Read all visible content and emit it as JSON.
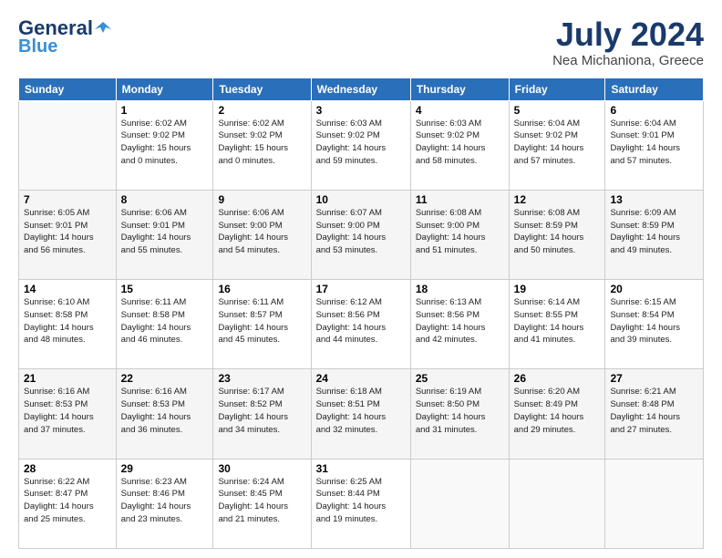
{
  "header": {
    "logo_line1": "General",
    "logo_line2": "Blue",
    "month": "July 2024",
    "location": "Nea Michaniona, Greece"
  },
  "weekdays": [
    "Sunday",
    "Monday",
    "Tuesday",
    "Wednesday",
    "Thursday",
    "Friday",
    "Saturday"
  ],
  "weeks": [
    [
      {
        "day": "",
        "sunrise": "",
        "sunset": "",
        "daylight": ""
      },
      {
        "day": "1",
        "sunrise": "Sunrise: 6:02 AM",
        "sunset": "Sunset: 9:02 PM",
        "daylight": "Daylight: 15 hours and 0 minutes."
      },
      {
        "day": "2",
        "sunrise": "Sunrise: 6:02 AM",
        "sunset": "Sunset: 9:02 PM",
        "daylight": "Daylight: 15 hours and 0 minutes."
      },
      {
        "day": "3",
        "sunrise": "Sunrise: 6:03 AM",
        "sunset": "Sunset: 9:02 PM",
        "daylight": "Daylight: 14 hours and 59 minutes."
      },
      {
        "day": "4",
        "sunrise": "Sunrise: 6:03 AM",
        "sunset": "Sunset: 9:02 PM",
        "daylight": "Daylight: 14 hours and 58 minutes."
      },
      {
        "day": "5",
        "sunrise": "Sunrise: 6:04 AM",
        "sunset": "Sunset: 9:02 PM",
        "daylight": "Daylight: 14 hours and 57 minutes."
      },
      {
        "day": "6",
        "sunrise": "Sunrise: 6:04 AM",
        "sunset": "Sunset: 9:01 PM",
        "daylight": "Daylight: 14 hours and 57 minutes."
      }
    ],
    [
      {
        "day": "7",
        "sunrise": "Sunrise: 6:05 AM",
        "sunset": "Sunset: 9:01 PM",
        "daylight": "Daylight: 14 hours and 56 minutes."
      },
      {
        "day": "8",
        "sunrise": "Sunrise: 6:06 AM",
        "sunset": "Sunset: 9:01 PM",
        "daylight": "Daylight: 14 hours and 55 minutes."
      },
      {
        "day": "9",
        "sunrise": "Sunrise: 6:06 AM",
        "sunset": "Sunset: 9:00 PM",
        "daylight": "Daylight: 14 hours and 54 minutes."
      },
      {
        "day": "10",
        "sunrise": "Sunrise: 6:07 AM",
        "sunset": "Sunset: 9:00 PM",
        "daylight": "Daylight: 14 hours and 53 minutes."
      },
      {
        "day": "11",
        "sunrise": "Sunrise: 6:08 AM",
        "sunset": "Sunset: 9:00 PM",
        "daylight": "Daylight: 14 hours and 51 minutes."
      },
      {
        "day": "12",
        "sunrise": "Sunrise: 6:08 AM",
        "sunset": "Sunset: 8:59 PM",
        "daylight": "Daylight: 14 hours and 50 minutes."
      },
      {
        "day": "13",
        "sunrise": "Sunrise: 6:09 AM",
        "sunset": "Sunset: 8:59 PM",
        "daylight": "Daylight: 14 hours and 49 minutes."
      }
    ],
    [
      {
        "day": "14",
        "sunrise": "Sunrise: 6:10 AM",
        "sunset": "Sunset: 8:58 PM",
        "daylight": "Daylight: 14 hours and 48 minutes."
      },
      {
        "day": "15",
        "sunrise": "Sunrise: 6:11 AM",
        "sunset": "Sunset: 8:58 PM",
        "daylight": "Daylight: 14 hours and 46 minutes."
      },
      {
        "day": "16",
        "sunrise": "Sunrise: 6:11 AM",
        "sunset": "Sunset: 8:57 PM",
        "daylight": "Daylight: 14 hours and 45 minutes."
      },
      {
        "day": "17",
        "sunrise": "Sunrise: 6:12 AM",
        "sunset": "Sunset: 8:56 PM",
        "daylight": "Daylight: 14 hours and 44 minutes."
      },
      {
        "day": "18",
        "sunrise": "Sunrise: 6:13 AM",
        "sunset": "Sunset: 8:56 PM",
        "daylight": "Daylight: 14 hours and 42 minutes."
      },
      {
        "day": "19",
        "sunrise": "Sunrise: 6:14 AM",
        "sunset": "Sunset: 8:55 PM",
        "daylight": "Daylight: 14 hours and 41 minutes."
      },
      {
        "day": "20",
        "sunrise": "Sunrise: 6:15 AM",
        "sunset": "Sunset: 8:54 PM",
        "daylight": "Daylight: 14 hours and 39 minutes."
      }
    ],
    [
      {
        "day": "21",
        "sunrise": "Sunrise: 6:16 AM",
        "sunset": "Sunset: 8:53 PM",
        "daylight": "Daylight: 14 hours and 37 minutes."
      },
      {
        "day": "22",
        "sunrise": "Sunrise: 6:16 AM",
        "sunset": "Sunset: 8:53 PM",
        "daylight": "Daylight: 14 hours and 36 minutes."
      },
      {
        "day": "23",
        "sunrise": "Sunrise: 6:17 AM",
        "sunset": "Sunset: 8:52 PM",
        "daylight": "Daylight: 14 hours and 34 minutes."
      },
      {
        "day": "24",
        "sunrise": "Sunrise: 6:18 AM",
        "sunset": "Sunset: 8:51 PM",
        "daylight": "Daylight: 14 hours and 32 minutes."
      },
      {
        "day": "25",
        "sunrise": "Sunrise: 6:19 AM",
        "sunset": "Sunset: 8:50 PM",
        "daylight": "Daylight: 14 hours and 31 minutes."
      },
      {
        "day": "26",
        "sunrise": "Sunrise: 6:20 AM",
        "sunset": "Sunset: 8:49 PM",
        "daylight": "Daylight: 14 hours and 29 minutes."
      },
      {
        "day": "27",
        "sunrise": "Sunrise: 6:21 AM",
        "sunset": "Sunset: 8:48 PM",
        "daylight": "Daylight: 14 hours and 27 minutes."
      }
    ],
    [
      {
        "day": "28",
        "sunrise": "Sunrise: 6:22 AM",
        "sunset": "Sunset: 8:47 PM",
        "daylight": "Daylight: 14 hours and 25 minutes."
      },
      {
        "day": "29",
        "sunrise": "Sunrise: 6:23 AM",
        "sunset": "Sunset: 8:46 PM",
        "daylight": "Daylight: 14 hours and 23 minutes."
      },
      {
        "day": "30",
        "sunrise": "Sunrise: 6:24 AM",
        "sunset": "Sunset: 8:45 PM",
        "daylight": "Daylight: 14 hours and 21 minutes."
      },
      {
        "day": "31",
        "sunrise": "Sunrise: 6:25 AM",
        "sunset": "Sunset: 8:44 PM",
        "daylight": "Daylight: 14 hours and 19 minutes."
      },
      {
        "day": "",
        "sunrise": "",
        "sunset": "",
        "daylight": ""
      },
      {
        "day": "",
        "sunrise": "",
        "sunset": "",
        "daylight": ""
      },
      {
        "day": "",
        "sunrise": "",
        "sunset": "",
        "daylight": ""
      }
    ]
  ]
}
